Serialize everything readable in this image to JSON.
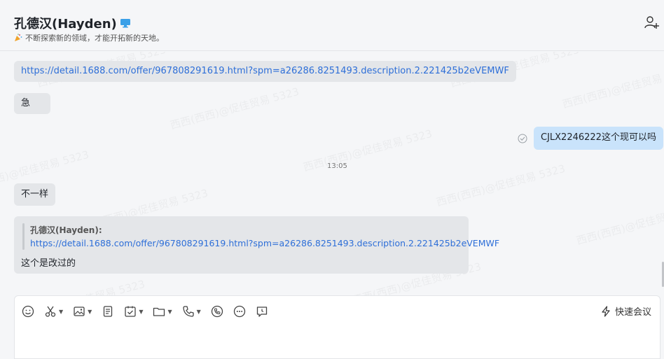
{
  "header": {
    "title": "孔德汉(Hayden)",
    "status": "不断探索新的领域，才能开拓新的天地。"
  },
  "window": {
    "controls": [
      "minimize",
      "maximize",
      "close"
    ]
  },
  "messages": [
    {
      "id": "m1",
      "side": "left",
      "type": "link",
      "text": "https://detail.1688.com/offer/967808291619.html?spm=a26286.8251493.description.2.221425b2eVEMWF"
    },
    {
      "id": "m2",
      "side": "left",
      "type": "text",
      "text": "急"
    },
    {
      "id": "m3",
      "side": "right",
      "type": "text",
      "text": "CJLX2246222这个现可以吗"
    },
    {
      "id": "t1",
      "type": "time",
      "text": "13:05"
    },
    {
      "id": "m4",
      "side": "left",
      "type": "text",
      "text": "不一样"
    },
    {
      "id": "m5",
      "side": "left",
      "type": "quote",
      "quote_author": "孔德汉(Hayden):",
      "quote_link": "https://detail.1688.com/offer/967808291619.html?spm=a26286.8251493.description.2.221425b2eVEMWF",
      "reply": "这个是改过的"
    }
  ],
  "watermark_text": "西西(西西)@促佳贸易 5323",
  "composer": {
    "tools": [
      "emoji-icon",
      "scissors-icon",
      "image-icon",
      "document-icon",
      "task-icon",
      "folder-icon",
      "phone-icon",
      "recall-icon",
      "more-icon",
      "schedule-icon"
    ],
    "quick_meeting_label": "快速会议"
  },
  "colors": {
    "background": "#f5f6f8",
    "bubble": "#e4e6e9",
    "my_bubble": "#c9e3fb",
    "link": "#2e6fd8"
  }
}
